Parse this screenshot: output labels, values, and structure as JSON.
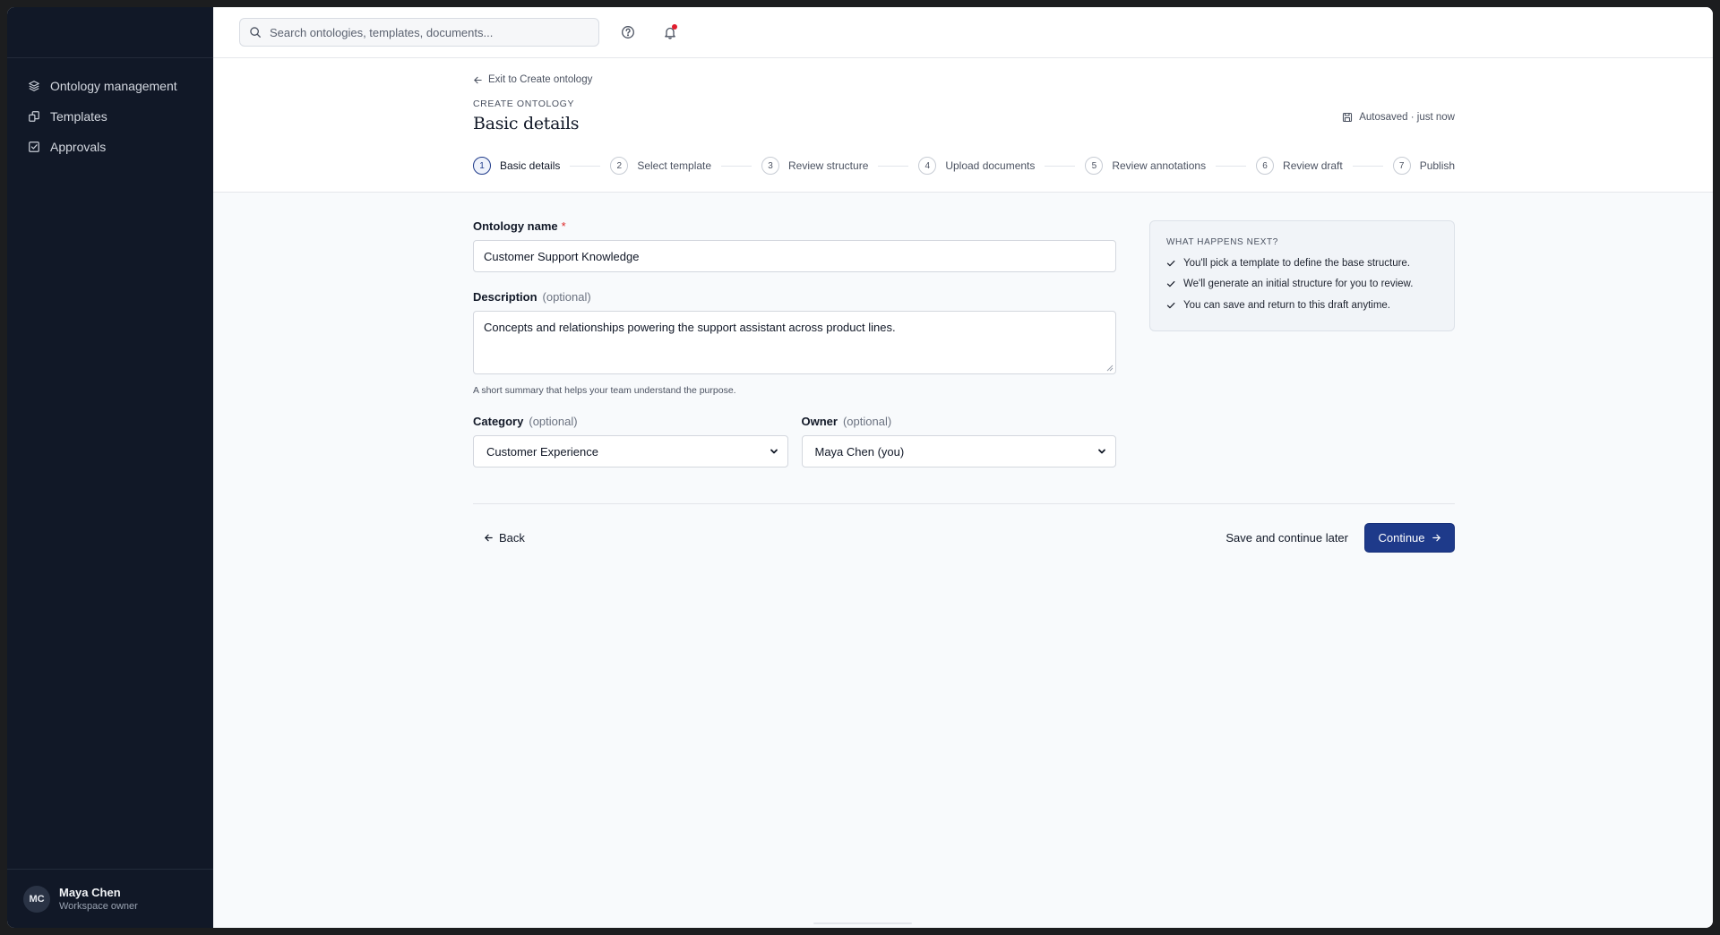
{
  "sidebar": {
    "items": [
      {
        "label": "Ontology management",
        "icon": "layers-icon"
      },
      {
        "label": "Templates",
        "icon": "templates-icon"
      },
      {
        "label": "Approvals",
        "icon": "checkbox-icon"
      }
    ],
    "user": {
      "initials": "MC",
      "name": "Maya Chen",
      "role": "Workspace owner"
    }
  },
  "topbar": {
    "search_placeholder": "Search ontologies, templates, documents...",
    "notification_dot_color": "#e11d2e"
  },
  "header": {
    "exit_link": "Exit to Create ontology",
    "eyebrow": "CREATE ONTOLOGY",
    "title": "Basic details",
    "autosave": "Autosaved · just now"
  },
  "steps": [
    {
      "num": "1",
      "label": "Basic details",
      "active": true
    },
    {
      "num": "2",
      "label": "Select template"
    },
    {
      "num": "3",
      "label": "Review structure"
    },
    {
      "num": "4",
      "label": "Upload documents"
    },
    {
      "num": "5",
      "label": "Review annotations"
    },
    {
      "num": "6",
      "label": "Review draft"
    },
    {
      "num": "7",
      "label": "Publish"
    }
  ],
  "form": {
    "name_label": "Ontology name",
    "required_mark": "*",
    "name_value": "Customer Support Knowledge",
    "description_label": "Description",
    "optional_text": "(optional)",
    "description_value": "Concepts and relationships powering the support assistant across product lines.",
    "description_hint": "A short summary that helps your team understand the purpose.",
    "category_label": "Category",
    "category_value": "Customer Experience",
    "owner_label": "Owner",
    "owner_value": "Maya Chen (you)"
  },
  "info_panel": {
    "heading": "WHAT HAPPENS NEXT?",
    "items": [
      "You'll pick a template to define the base structure.",
      "We'll generate an initial structure for you to review.",
      "You can save and return to this draft anytime."
    ]
  },
  "actions": {
    "back": "Back",
    "save_later": "Save and continue later",
    "continue": "Continue"
  },
  "colors": {
    "sidebar_bg": "#111827",
    "accent": "#1e3a8a",
    "required": "#dc2626"
  }
}
